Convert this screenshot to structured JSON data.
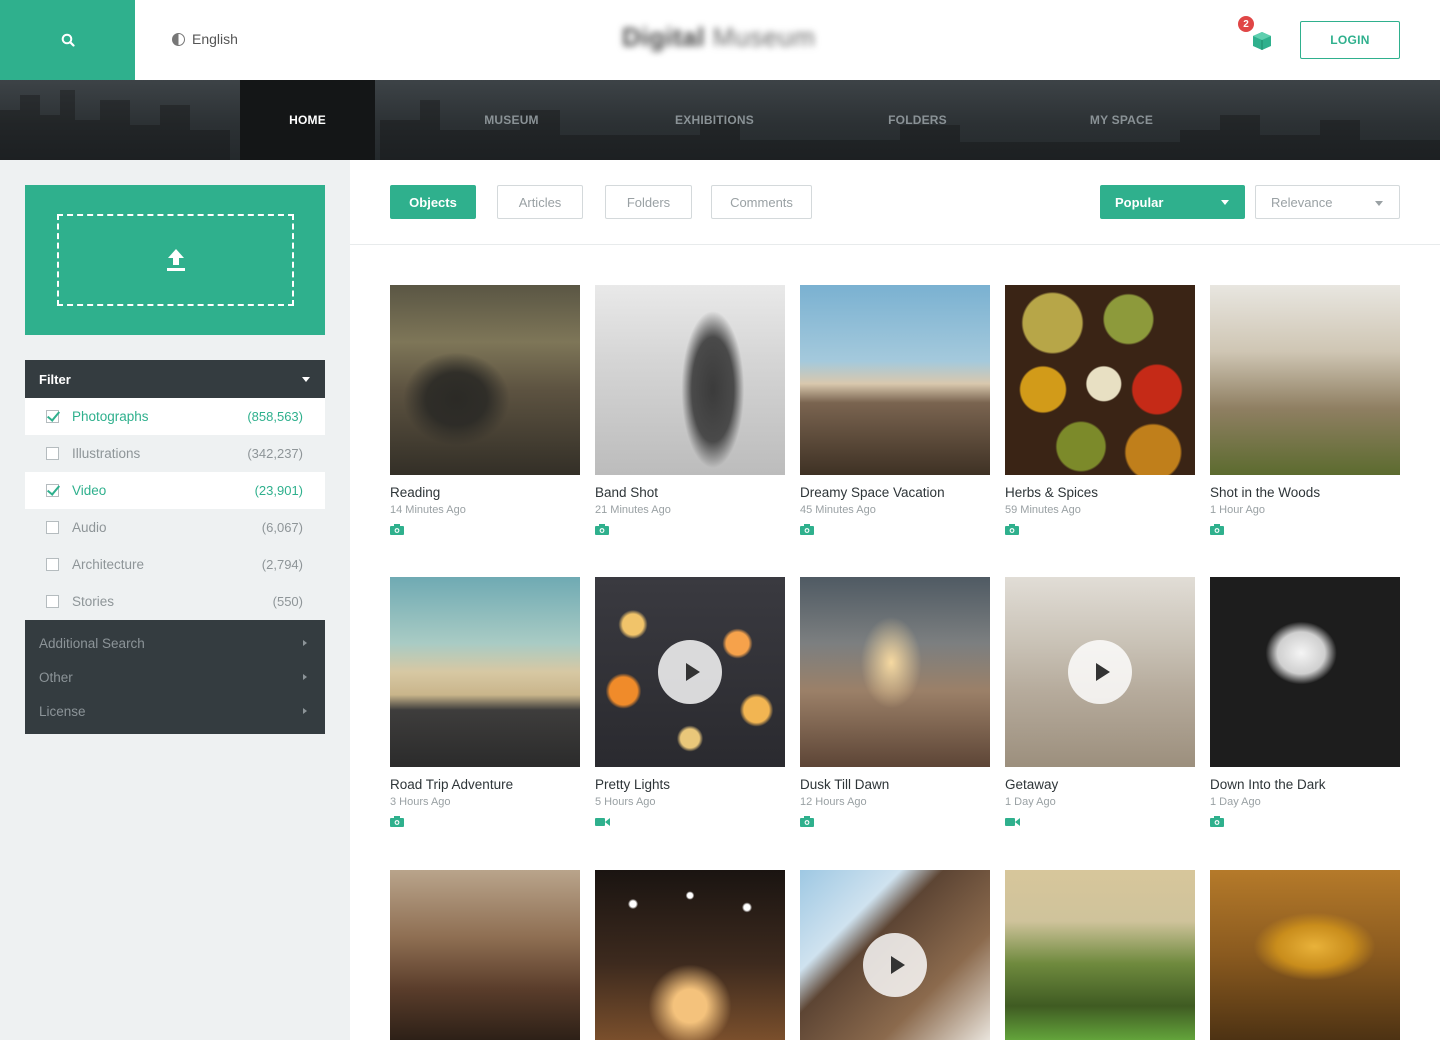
{
  "header": {
    "language": "English",
    "brand_bold": "Digital",
    "brand_rest": " Museum",
    "cart_count": "2",
    "login_label": "LOGIN",
    "accent_color": "#2fb08d",
    "badge_color": "#e04646"
  },
  "nav": {
    "items": [
      {
        "label": "HOME",
        "active": true
      },
      {
        "label": "MUSEUM"
      },
      {
        "label": "EXHIBITIONS"
      },
      {
        "label": "FOLDERS"
      },
      {
        "label": "MY SPACE"
      }
    ]
  },
  "sidebar": {
    "upload_icon": "upload-icon",
    "filter_title": "Filter",
    "filters": [
      {
        "label": "Photographs",
        "count": "(858,563)",
        "checked": true
      },
      {
        "label": "Illustrations",
        "count": "(342,237)",
        "checked": false
      },
      {
        "label": "Video",
        "count": "(23,901)",
        "checked": true
      },
      {
        "label": "Audio",
        "count": "(6,067)",
        "checked": false
      },
      {
        "label": "Architecture",
        "count": "(2,794)",
        "checked": false
      },
      {
        "label": "Stories",
        "count": "(550)",
        "checked": false
      }
    ],
    "more": [
      {
        "label": "Additional Search"
      },
      {
        "label": "Other"
      },
      {
        "label": "License"
      }
    ]
  },
  "tabs": [
    {
      "label": "Objects",
      "active": true
    },
    {
      "label": "Articles"
    },
    {
      "label": "Folders"
    },
    {
      "label": "Comments"
    }
  ],
  "sort": {
    "primary": "Popular",
    "secondary": "Relevance"
  },
  "cards": [
    {
      "title": "Reading",
      "time": "14 Minutes Ago",
      "media": "camera-icon"
    },
    {
      "title": "Band Shot",
      "time": "21 Minutes Ago",
      "media": "camera-icon"
    },
    {
      "title": "Dreamy Space Vacation",
      "time": "45 Minutes Ago",
      "media": "camera-icon"
    },
    {
      "title": "Herbs & Spices",
      "time": "59 Minutes Ago",
      "media": "camera-icon"
    },
    {
      "title": "Shot in the Woods",
      "time": "1 Hour Ago",
      "media": "camera-icon"
    },
    {
      "title": "Road Trip Adventure",
      "time": "3 Hours Ago",
      "media": "camera-icon"
    },
    {
      "title": "Pretty Lights",
      "time": "5 Hours Ago",
      "media": "video-camera-icon"
    },
    {
      "title": "Dusk Till Dawn",
      "time": "12 Hours Ago",
      "media": "camera-icon"
    },
    {
      "title": "Getaway",
      "time": "1 Day Ago",
      "media": "video-camera-icon"
    },
    {
      "title": "Down Into the Dark",
      "time": "1 Day Ago",
      "media": "camera-icon"
    },
    {
      "title": "",
      "time": "",
      "media": ""
    },
    {
      "title": "",
      "time": "",
      "media": ""
    },
    {
      "title": "",
      "time": "",
      "media": ""
    },
    {
      "title": "",
      "time": "",
      "media": ""
    },
    {
      "title": "",
      "time": "",
      "media": ""
    }
  ]
}
